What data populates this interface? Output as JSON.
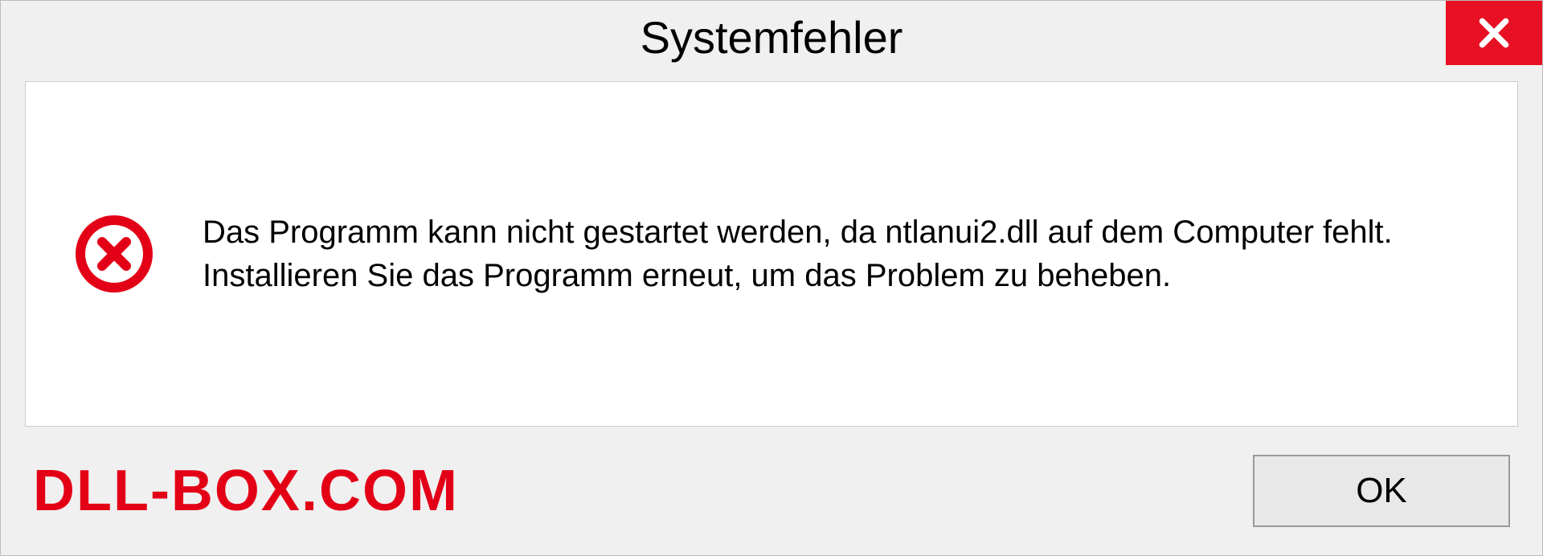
{
  "dialog": {
    "title": "Systemfehler",
    "message": "Das Programm kann nicht gestartet werden, da ntlanui2.dll auf dem Computer fehlt. Installieren Sie das Programm erneut, um das Problem zu beheben.",
    "ok_label": "OK"
  },
  "watermark": "DLL-BOX.COM",
  "colors": {
    "close_bg": "#e81123",
    "error_icon": "#e30016",
    "watermark": "#e30016"
  }
}
